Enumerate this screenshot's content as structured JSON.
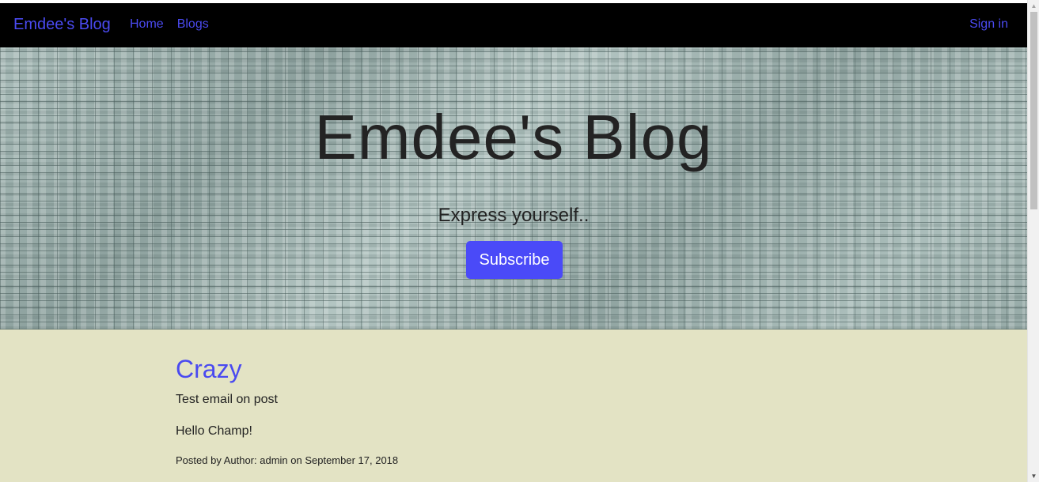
{
  "navbar": {
    "brand": "Emdee's Blog",
    "links": [
      {
        "label": "Home"
      },
      {
        "label": "Blogs"
      }
    ],
    "signin": "Sign in",
    "link_color": "#4a4af0",
    "background": "#000000"
  },
  "hero": {
    "title": "Emdee's Blog",
    "subtitle": "Express yourself..",
    "subscribe_label": "Subscribe",
    "button_color": "#4a4af8"
  },
  "posts": [
    {
      "title": "Crazy",
      "summary": "Test email on post",
      "body": "Hello Champ!",
      "meta": "Posted by Author: admin on September 17, 2018"
    }
  ],
  "content_background": "#e3e3c4",
  "icons": {
    "scroll_up": "scroll-up-arrow-icon",
    "scroll_down": "scroll-down-arrow-icon"
  }
}
